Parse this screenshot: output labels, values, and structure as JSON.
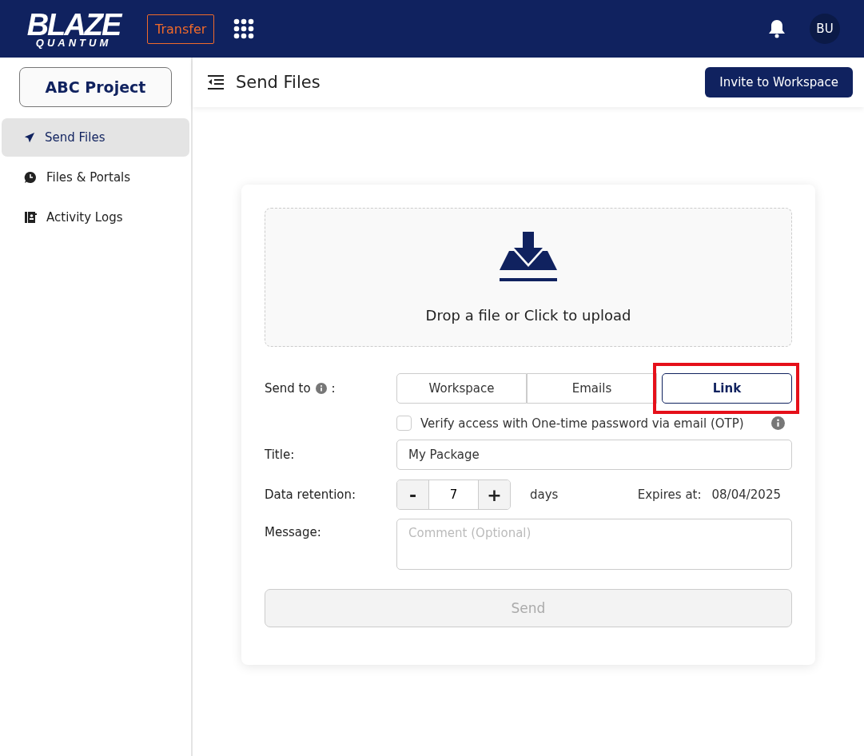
{
  "header": {
    "logo": {
      "top": "BLAZE",
      "bottom": "QUANTUM"
    },
    "app_button": "Transfer",
    "avatar": "BU"
  },
  "sidebar": {
    "project": "ABC Project",
    "items": [
      {
        "label": "Send Files",
        "kind": "send",
        "selected": true
      },
      {
        "label": "Files & Portals",
        "kind": "clock",
        "selected": false
      },
      {
        "label": "Activity Logs",
        "kind": "logs",
        "selected": false
      }
    ]
  },
  "page": {
    "title": "Send Files",
    "invite_button": "Invite to Workspace"
  },
  "upload": {
    "text": "Drop a file or Click to upload"
  },
  "send_to": {
    "label": "Send to",
    "colon": ":",
    "options": [
      {
        "label": "Workspace",
        "selected": false,
        "highlighted": false
      },
      {
        "label": "Emails",
        "selected": false,
        "highlighted": false
      },
      {
        "label": "Link",
        "selected": true,
        "highlighted": true
      }
    ]
  },
  "otp": {
    "label": "Verify access with One-time password via email (OTP)",
    "checked": false
  },
  "title": {
    "label": "Title:",
    "value": "My Package"
  },
  "retention": {
    "label": "Data retention:",
    "minus": "-",
    "value": "7",
    "plus": "+",
    "unit": "days",
    "expires_label": "Expires at:",
    "expires_value": "08/04/2025"
  },
  "message": {
    "label": "Message:",
    "placeholder": "Comment (Optional)"
  },
  "send_button": {
    "label": "Send",
    "disabled": true
  }
}
